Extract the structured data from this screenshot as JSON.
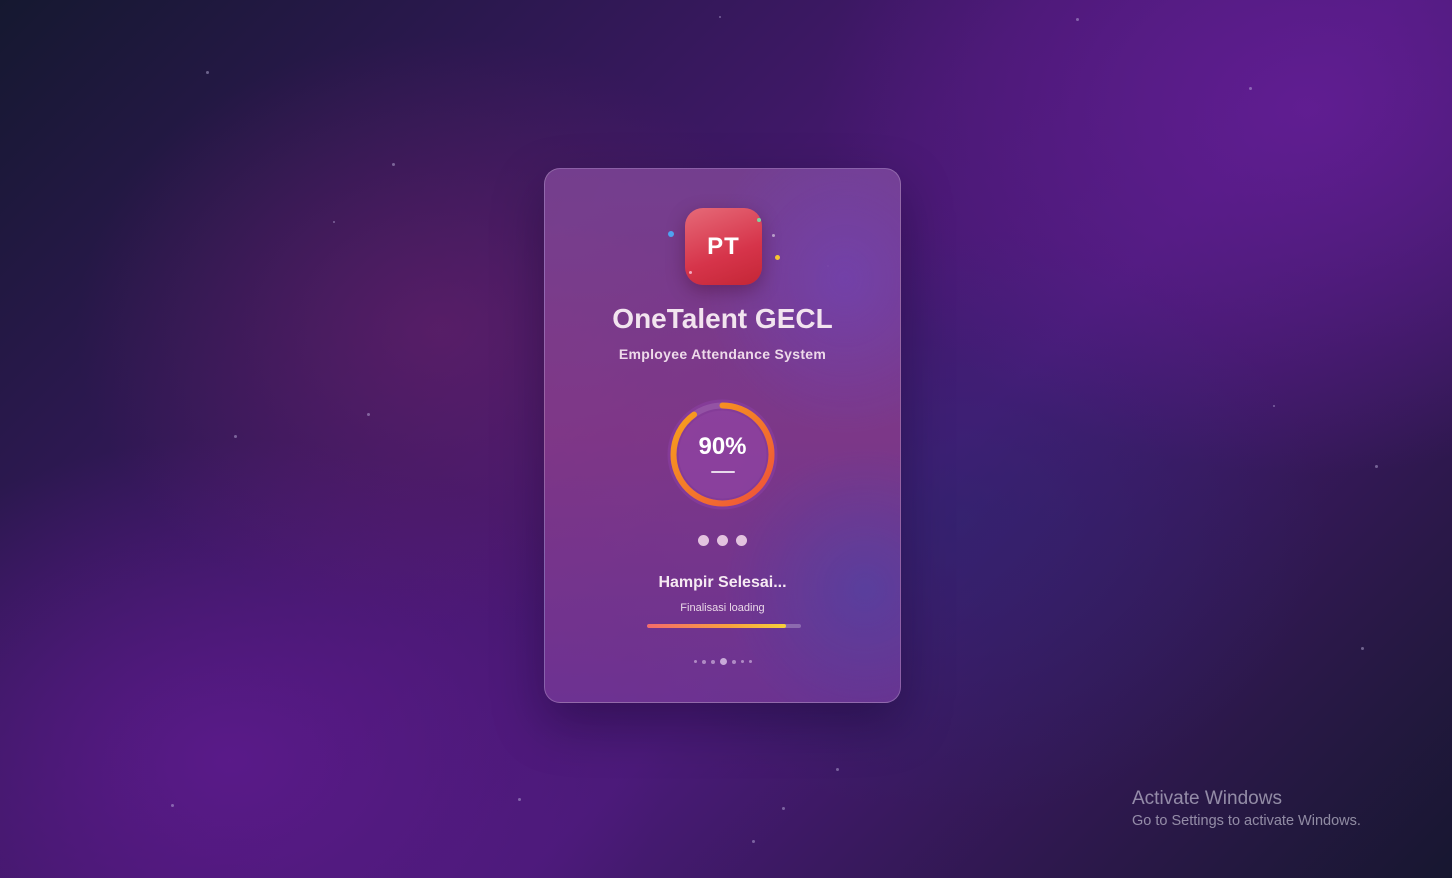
{
  "app": {
    "logo_text": "PT",
    "title": "OneTalent GECL",
    "subtitle": "Employee Attendance System"
  },
  "loading": {
    "percent_text": "90%",
    "percent": 90,
    "status": "Hampir Selesai...",
    "substatus": "Finalisasi loading",
    "bar_progress": 0.9
  },
  "watermark": {
    "title": "Activate Windows",
    "subtitle": "Go to Settings to activate Windows."
  },
  "colors": {
    "logo": "#d6344a",
    "ring_start": "#ef4f3a",
    "ring_end": "#f8a41a",
    "bar_start": "#f56b6b",
    "bar_end": "#f6d13a"
  }
}
